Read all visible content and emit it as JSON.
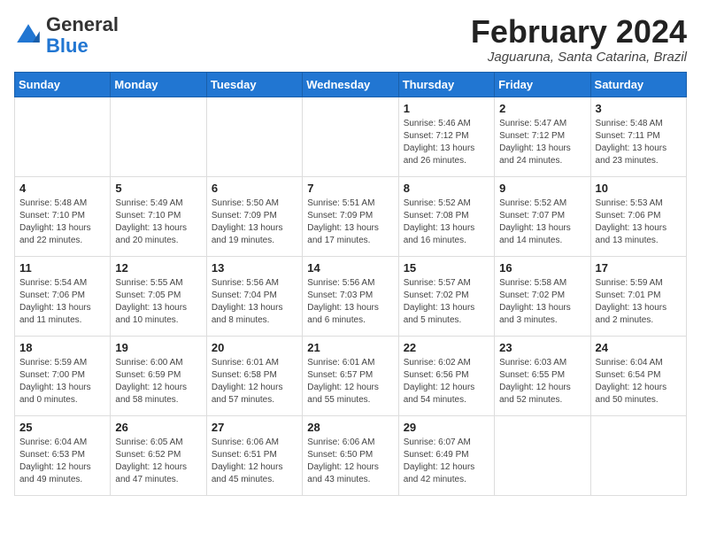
{
  "header": {
    "logo_general": "General",
    "logo_blue": "Blue",
    "month_year": "February 2024",
    "location": "Jaguaruna, Santa Catarina, Brazil"
  },
  "weekdays": [
    "Sunday",
    "Monday",
    "Tuesday",
    "Wednesday",
    "Thursday",
    "Friday",
    "Saturday"
  ],
  "weeks": [
    [
      {
        "day": "",
        "detail": ""
      },
      {
        "day": "",
        "detail": ""
      },
      {
        "day": "",
        "detail": ""
      },
      {
        "day": "",
        "detail": ""
      },
      {
        "day": "1",
        "detail": "Sunrise: 5:46 AM\nSunset: 7:12 PM\nDaylight: 13 hours\nand 26 minutes."
      },
      {
        "day": "2",
        "detail": "Sunrise: 5:47 AM\nSunset: 7:12 PM\nDaylight: 13 hours\nand 24 minutes."
      },
      {
        "day": "3",
        "detail": "Sunrise: 5:48 AM\nSunset: 7:11 PM\nDaylight: 13 hours\nand 23 minutes."
      }
    ],
    [
      {
        "day": "4",
        "detail": "Sunrise: 5:48 AM\nSunset: 7:10 PM\nDaylight: 13 hours\nand 22 minutes."
      },
      {
        "day": "5",
        "detail": "Sunrise: 5:49 AM\nSunset: 7:10 PM\nDaylight: 13 hours\nand 20 minutes."
      },
      {
        "day": "6",
        "detail": "Sunrise: 5:50 AM\nSunset: 7:09 PM\nDaylight: 13 hours\nand 19 minutes."
      },
      {
        "day": "7",
        "detail": "Sunrise: 5:51 AM\nSunset: 7:09 PM\nDaylight: 13 hours\nand 17 minutes."
      },
      {
        "day": "8",
        "detail": "Sunrise: 5:52 AM\nSunset: 7:08 PM\nDaylight: 13 hours\nand 16 minutes."
      },
      {
        "day": "9",
        "detail": "Sunrise: 5:52 AM\nSunset: 7:07 PM\nDaylight: 13 hours\nand 14 minutes."
      },
      {
        "day": "10",
        "detail": "Sunrise: 5:53 AM\nSunset: 7:06 PM\nDaylight: 13 hours\nand 13 minutes."
      }
    ],
    [
      {
        "day": "11",
        "detail": "Sunrise: 5:54 AM\nSunset: 7:06 PM\nDaylight: 13 hours\nand 11 minutes."
      },
      {
        "day": "12",
        "detail": "Sunrise: 5:55 AM\nSunset: 7:05 PM\nDaylight: 13 hours\nand 10 minutes."
      },
      {
        "day": "13",
        "detail": "Sunrise: 5:56 AM\nSunset: 7:04 PM\nDaylight: 13 hours\nand 8 minutes."
      },
      {
        "day": "14",
        "detail": "Sunrise: 5:56 AM\nSunset: 7:03 PM\nDaylight: 13 hours\nand 6 minutes."
      },
      {
        "day": "15",
        "detail": "Sunrise: 5:57 AM\nSunset: 7:02 PM\nDaylight: 13 hours\nand 5 minutes."
      },
      {
        "day": "16",
        "detail": "Sunrise: 5:58 AM\nSunset: 7:02 PM\nDaylight: 13 hours\nand 3 minutes."
      },
      {
        "day": "17",
        "detail": "Sunrise: 5:59 AM\nSunset: 7:01 PM\nDaylight: 13 hours\nand 2 minutes."
      }
    ],
    [
      {
        "day": "18",
        "detail": "Sunrise: 5:59 AM\nSunset: 7:00 PM\nDaylight: 13 hours\nand 0 minutes."
      },
      {
        "day": "19",
        "detail": "Sunrise: 6:00 AM\nSunset: 6:59 PM\nDaylight: 12 hours\nand 58 minutes."
      },
      {
        "day": "20",
        "detail": "Sunrise: 6:01 AM\nSunset: 6:58 PM\nDaylight: 12 hours\nand 57 minutes."
      },
      {
        "day": "21",
        "detail": "Sunrise: 6:01 AM\nSunset: 6:57 PM\nDaylight: 12 hours\nand 55 minutes."
      },
      {
        "day": "22",
        "detail": "Sunrise: 6:02 AM\nSunset: 6:56 PM\nDaylight: 12 hours\nand 54 minutes."
      },
      {
        "day": "23",
        "detail": "Sunrise: 6:03 AM\nSunset: 6:55 PM\nDaylight: 12 hours\nand 52 minutes."
      },
      {
        "day": "24",
        "detail": "Sunrise: 6:04 AM\nSunset: 6:54 PM\nDaylight: 12 hours\nand 50 minutes."
      }
    ],
    [
      {
        "day": "25",
        "detail": "Sunrise: 6:04 AM\nSunset: 6:53 PM\nDaylight: 12 hours\nand 49 minutes."
      },
      {
        "day": "26",
        "detail": "Sunrise: 6:05 AM\nSunset: 6:52 PM\nDaylight: 12 hours\nand 47 minutes."
      },
      {
        "day": "27",
        "detail": "Sunrise: 6:06 AM\nSunset: 6:51 PM\nDaylight: 12 hours\nand 45 minutes."
      },
      {
        "day": "28",
        "detail": "Sunrise: 6:06 AM\nSunset: 6:50 PM\nDaylight: 12 hours\nand 43 minutes."
      },
      {
        "day": "29",
        "detail": "Sunrise: 6:07 AM\nSunset: 6:49 PM\nDaylight: 12 hours\nand 42 minutes."
      },
      {
        "day": "",
        "detail": ""
      },
      {
        "day": "",
        "detail": ""
      }
    ]
  ]
}
